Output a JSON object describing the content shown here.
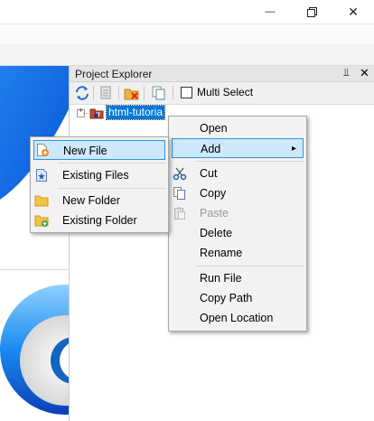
{
  "window": {
    "minimize_glyph": "—",
    "maximize_glyph": "❐",
    "close_glyph": "✕"
  },
  "project_explorer": {
    "title": "Project Explorer",
    "pin_glyph": "⫫",
    "close_glyph": "✕",
    "toolbar": {
      "icons": [
        "refresh-icon",
        "properties-icon",
        "remove-icon",
        "copy-icon"
      ],
      "multi_select_label": "Multi Select",
      "multi_select_checked": false
    },
    "tree": {
      "expander_glyph": "+",
      "root_label": "html-tutoria"
    }
  },
  "context_menu": {
    "items": [
      {
        "label": "Open",
        "icon": ""
      },
      {
        "label": "Add",
        "icon": "",
        "submenu": true,
        "highlighted": true
      },
      {
        "label": "Cut",
        "icon": "scissors-icon"
      },
      {
        "label": "Copy",
        "icon": "copy-icon"
      },
      {
        "label": "Paste",
        "icon": "paste-icon",
        "disabled": true
      },
      {
        "label": "Delete",
        "icon": ""
      },
      {
        "label": "Rename",
        "icon": ""
      },
      {
        "label": "Run File",
        "icon": ""
      },
      {
        "label": "Copy Path",
        "icon": ""
      },
      {
        "label": "Open Location",
        "icon": ""
      }
    ],
    "submenu_arrow": "▸"
  },
  "add_submenu": {
    "items": [
      {
        "label": "New File",
        "icon": "new-file-icon",
        "highlighted": true
      },
      {
        "label": "Existing Files",
        "icon": "existing-files-icon"
      },
      {
        "label": "New Folder",
        "icon": "folder-icon"
      },
      {
        "label": "Existing Folder",
        "icon": "existing-folder-icon"
      }
    ]
  },
  "colors": {
    "accent": "#0078d7",
    "highlight_bg": "#cde8fa",
    "highlight_border": "#2d97d9",
    "menu_bg": "#f2f2f2"
  }
}
